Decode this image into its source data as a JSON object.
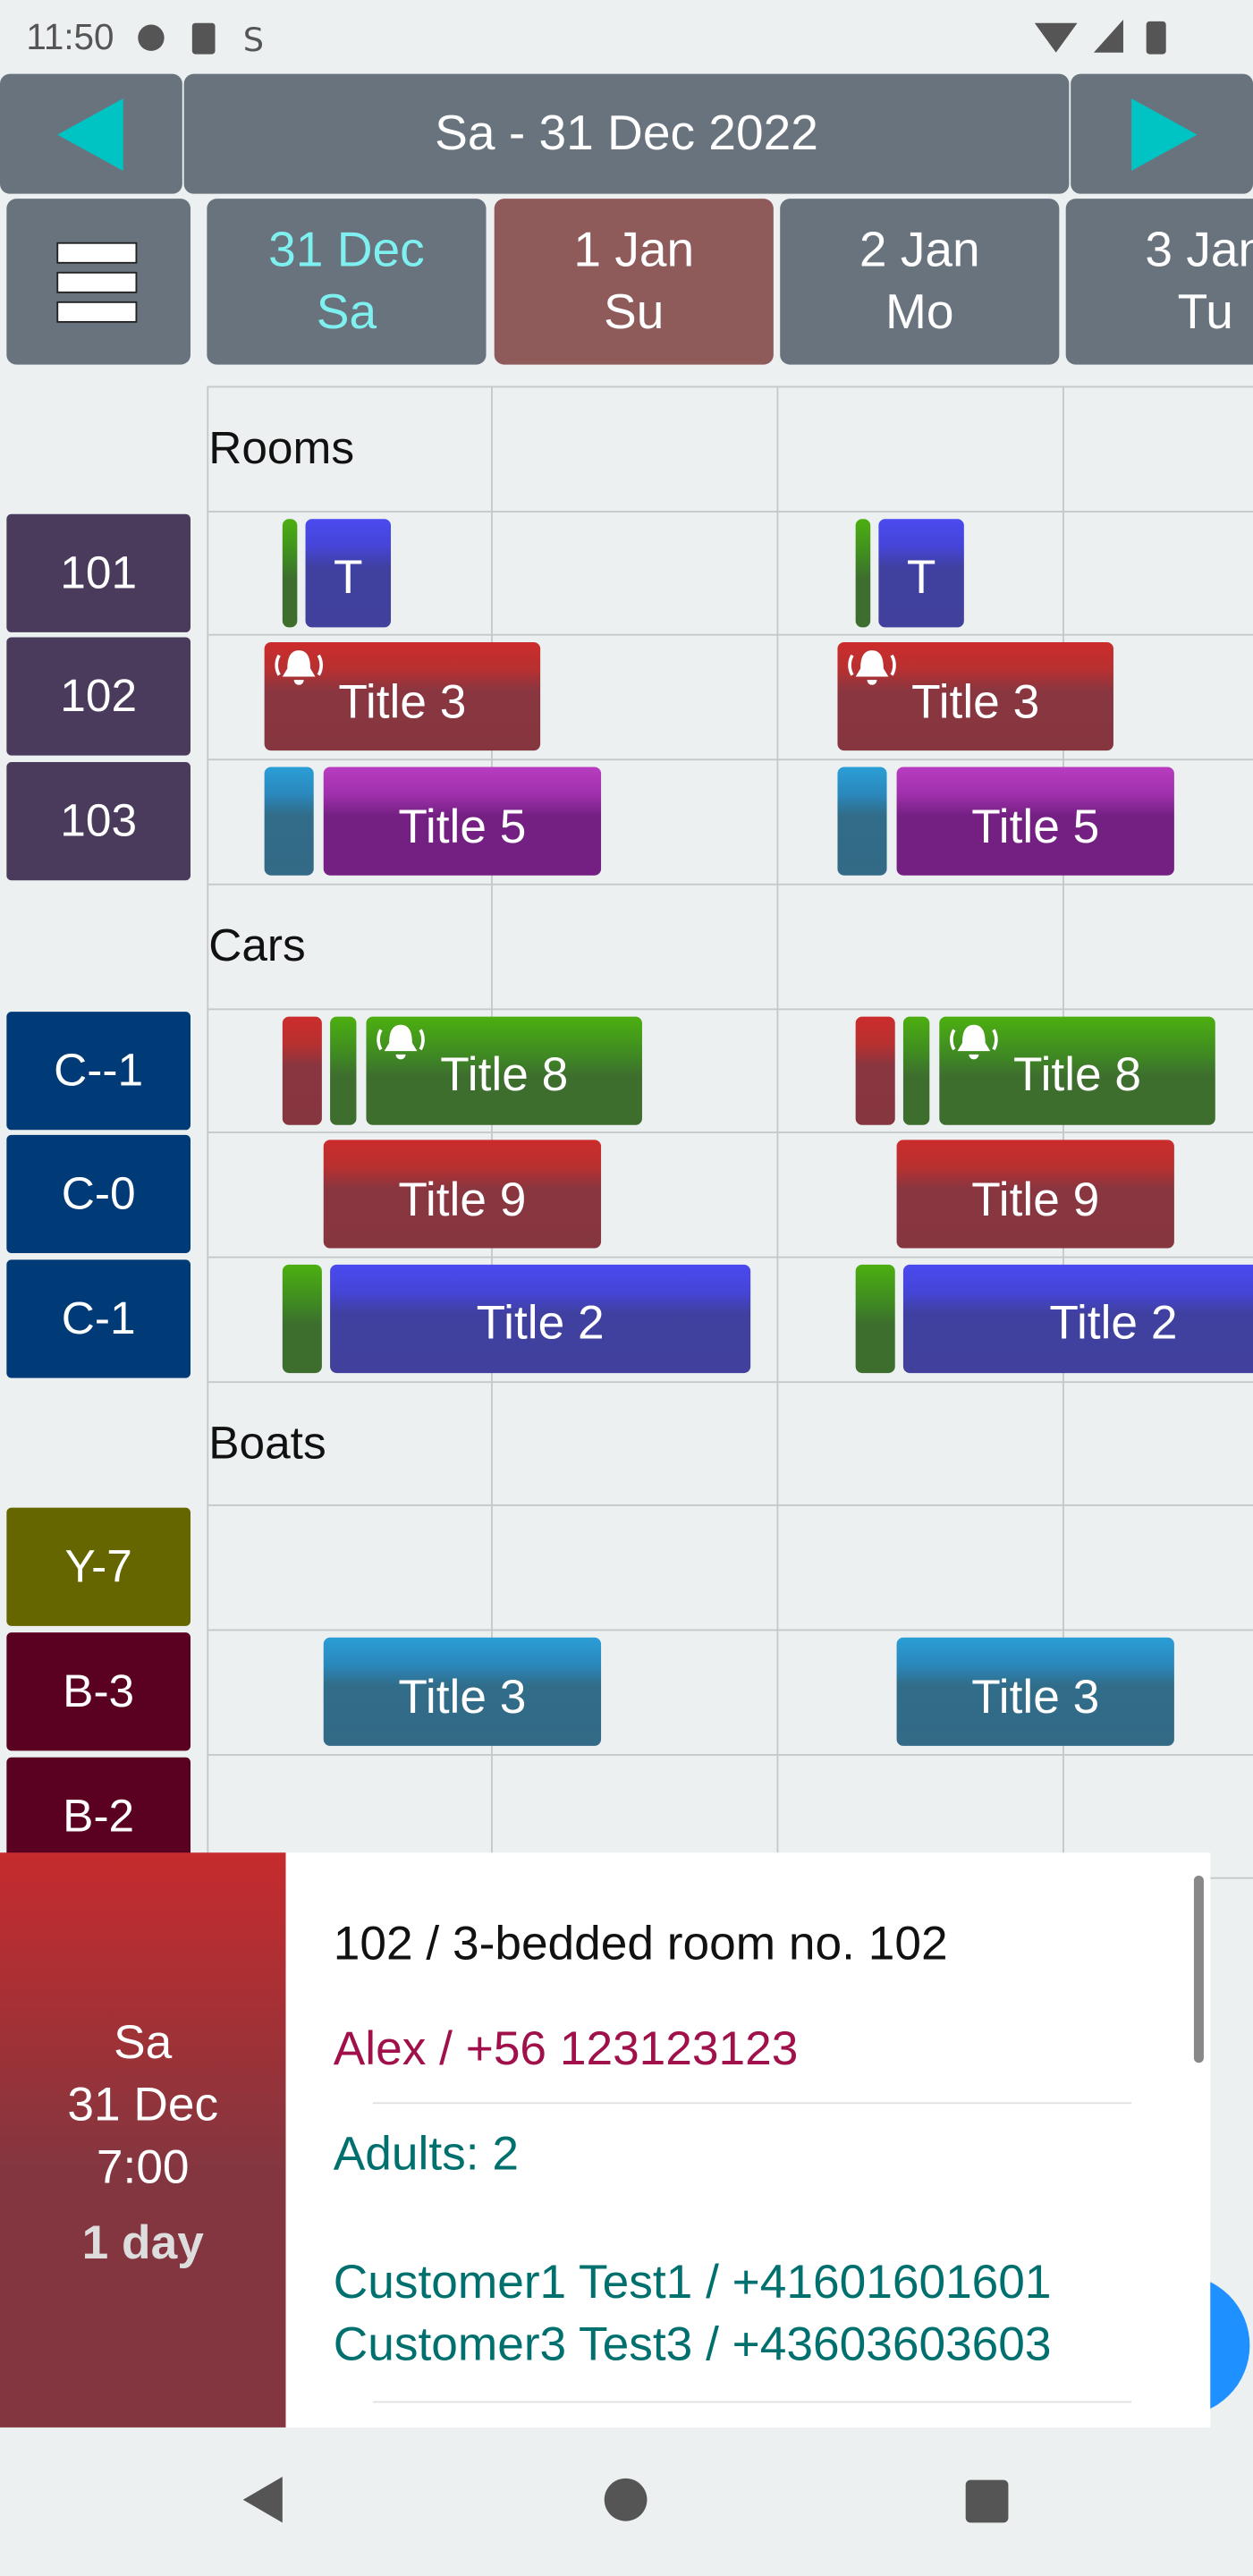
{
  "status_bar": {
    "time": "11:50",
    "icons": [
      "notification-icon",
      "sd-card-icon",
      "sync-icon",
      "wifi-icon",
      "signal-icon",
      "battery-icon"
    ]
  },
  "header": {
    "title": "Sa - 31 Dec 2022",
    "prev_icon": "triangle-left-icon",
    "next_icon": "triangle-right-icon",
    "accent": "#00c4c4"
  },
  "days": [
    {
      "date": "31 Dec",
      "weekday": "Sa",
      "state": "today"
    },
    {
      "date": "1 Jan",
      "weekday": "Su",
      "state": "selected"
    },
    {
      "date": "2 Jan",
      "weekday": "Mo",
      "state": "normal"
    },
    {
      "date": "3 Jan",
      "weekday": "Tu",
      "state": "normal"
    }
  ],
  "sections": [
    "Rooms",
    "Cars",
    "Boats"
  ],
  "resources": [
    {
      "label": "101",
      "color": "#4a3b5c"
    },
    {
      "label": "102",
      "color": "#4a3b5c"
    },
    {
      "label": "103",
      "color": "#4a3b5c"
    },
    {
      "label": "C--1",
      "color": "#003b77"
    },
    {
      "label": "C-0",
      "color": "#003b77"
    },
    {
      "label": "C-1",
      "color": "#003b77"
    },
    {
      "label": "Y-7",
      "color": "#666600"
    },
    {
      "label": "B-3",
      "color": "#5a0020"
    },
    {
      "label": "B-2",
      "color": "#5a0020"
    }
  ],
  "events": [
    {
      "resource": "101",
      "title": "",
      "color": "green"
    },
    {
      "resource": "101",
      "title": "T",
      "color": "blue"
    },
    {
      "resource": "102",
      "title": "Title 3",
      "color": "red",
      "alarm": true
    },
    {
      "resource": "103",
      "title": "",
      "color": "teal"
    },
    {
      "resource": "103",
      "title": "Title 5",
      "color": "purple"
    },
    {
      "resource": "C--1",
      "title": "",
      "color": "red"
    },
    {
      "resource": "C--1",
      "title": "",
      "color": "green"
    },
    {
      "resource": "C--1",
      "title": "Title 8",
      "color": "green",
      "alarm": true
    },
    {
      "resource": "C-0",
      "title": "Title 9",
      "color": "red"
    },
    {
      "resource": "C-1",
      "title": "",
      "color": "green"
    },
    {
      "resource": "C-1",
      "title": "Title 2",
      "color": "blue"
    },
    {
      "resource": "B-3",
      "title": "Title 3",
      "color": "teal"
    }
  ],
  "detail": {
    "weekday": "Sa",
    "date": "31 Dec",
    "time": "7:00",
    "duration": "1 day",
    "resource": "102  /  3-bedded room no. 102",
    "contact": "Alex / +56 123123123",
    "adults": "Adults: 2",
    "customers": [
      "Customer1 Test1 / +41601601601",
      "Customer3 Test3 / +43603603603"
    ]
  },
  "nav": {
    "back_icon": "back-icon",
    "home_icon": "home-icon",
    "recents_icon": "recents-icon"
  }
}
